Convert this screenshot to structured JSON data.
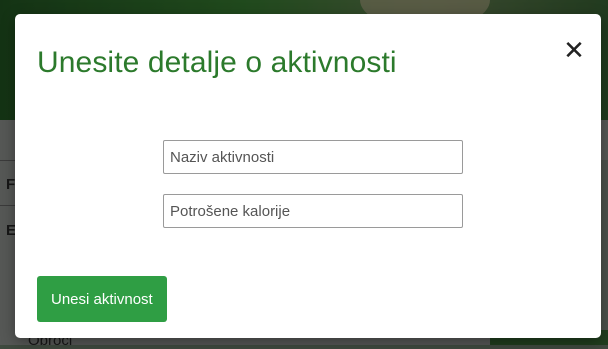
{
  "modal": {
    "title": "Unesite detalje o aktivnosti",
    "close_glyph": "✕",
    "close_icon": "close-icon",
    "fields": {
      "activity_name_placeholder": "Naziv aktivnosti",
      "activity_name_value": "",
      "calories_placeholder": "Potrošene kalorije",
      "calories_value": ""
    },
    "submit_label": "Unesi aktivnost"
  },
  "background": {
    "bottom_text": "Obroci",
    "left_letters": [
      "F",
      "E"
    ]
  },
  "colors": {
    "title_green": "#2c7a2c",
    "button_green": "#2f9e44"
  }
}
